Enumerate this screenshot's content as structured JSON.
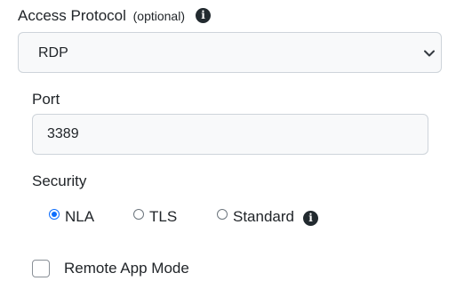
{
  "access_protocol": {
    "label": "Access Protocol",
    "optional_note": "(optional)",
    "info_icon": "info-circle-icon",
    "selected_value": "RDP"
  },
  "port": {
    "label": "Port",
    "value": "3389"
  },
  "security": {
    "label": "Security",
    "options": [
      {
        "label": "NLA",
        "checked": true
      },
      {
        "label": "TLS",
        "checked": false
      },
      {
        "label": "Standard",
        "checked": false
      }
    ],
    "standard_info_icon": "info-circle-icon"
  },
  "remote_app": {
    "label": "Remote App Mode",
    "checked": false
  },
  "colors": {
    "accent": "#0d6efd",
    "field_background": "#f8f9fa",
    "border": "#ced4da",
    "info_icon_background": "#222a2f"
  }
}
